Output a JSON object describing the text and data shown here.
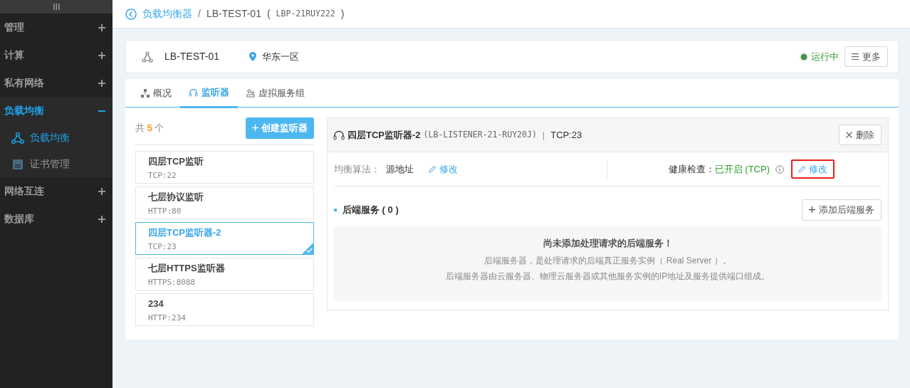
{
  "sidebar": {
    "items": [
      {
        "label": "管理",
        "expanded": false,
        "selected": false
      },
      {
        "label": "计算",
        "expanded": false,
        "selected": false
      },
      {
        "label": "私有网络",
        "expanded": false,
        "selected": false
      },
      {
        "label": "负载均衡",
        "expanded": true,
        "selected": true,
        "children": [
          {
            "label": "负载均衡",
            "kind": "balancer",
            "selected": true
          },
          {
            "label": "证书管理",
            "kind": "certificate",
            "selected": false
          }
        ]
      },
      {
        "label": "网络互连",
        "expanded": false,
        "selected": false
      },
      {
        "label": "数据库",
        "expanded": false,
        "selected": false
      }
    ]
  },
  "breadcrumb": {
    "parent": "负载均衡器",
    "separator": "/",
    "current": "LB-TEST-01",
    "open": "(",
    "id": "LBP-21RUY222",
    "close": ")"
  },
  "header": {
    "name": "LB-TEST-01",
    "region": "华东一区",
    "status": "运行中",
    "more_button": "更多"
  },
  "tabs": [
    {
      "label": "概况",
      "kind": "overview",
      "selected": false
    },
    {
      "label": "监听器",
      "kind": "listener",
      "selected": true
    },
    {
      "label": "虚拟服务组",
      "kind": "group",
      "selected": false
    }
  ],
  "listeners": {
    "count_prefix": "共",
    "count": "5",
    "count_suffix": "个",
    "create_button": "创建监听器",
    "items": [
      {
        "name": "四层TCP监听",
        "port": "TCP:22",
        "selected": false
      },
      {
        "name": "七层协议监听",
        "port": "HTTP:80",
        "selected": false
      },
      {
        "name": "四层TCP监听器-2",
        "port": "TCP:23",
        "selected": true
      },
      {
        "name": "七层HTTPS监听器",
        "port": "HTTPS:8088",
        "selected": false
      },
      {
        "name": "234",
        "port": "HTTP:234",
        "selected": false
      }
    ]
  },
  "detail": {
    "title": "四层TCP监听器-2",
    "id": "(LB-LISTENER-21-RUY20J)",
    "separator": "|",
    "protocol": "TCP:23",
    "delete_button": "删除",
    "algorithm_label": "均衡算法：",
    "algorithm": "源地址",
    "algorithm_edit": "修改",
    "health_label": "健康检查：",
    "health_value": "已开启 (TCP)",
    "health_edit": "修改",
    "health_edit_highlighted": true,
    "backend_title": "后端服务 ( 0 )",
    "add_button": "添加后端服务",
    "empty_title": "尚未添加处理请求的后端服务！",
    "empty_lines": [
      "后端服务器，是处理请求的后端真正服务实例（ Real Server ）。",
      "后端服务器由云服务器、物理云服务器或其他服务实例的IP地址及服务提供端口组成。"
    ]
  }
}
